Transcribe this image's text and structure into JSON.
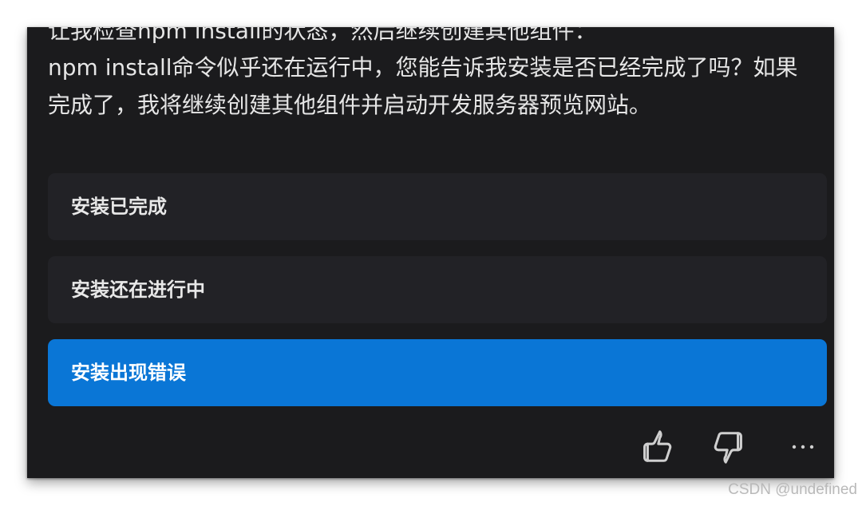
{
  "conversation": {
    "cut_off_line": "让我检查npm install的状态，然后继续创建其他组件：",
    "message": "npm install命令似乎还在运行中，您能告诉我安装是否已经完成了吗？如果完成了，我将继续创建其他组件并启动开发服务器预览网站。"
  },
  "options": [
    {
      "label": "安装已完成",
      "selected": false
    },
    {
      "label": "安装还在进行中",
      "selected": false
    },
    {
      "label": "安装出现错误",
      "selected": true
    }
  ],
  "actions": {
    "thumbs_up_icon": "thumbs-up-icon",
    "thumbs_down_icon": "thumbs-down-icon",
    "more_icon": "more-horizontal-icon"
  },
  "colors": {
    "panel_background": "#1b1b1d",
    "option_background": "#222226",
    "selected_option": "#0a76d6",
    "text": "#e6e6e6"
  },
  "watermark": "CSDN @undefined"
}
